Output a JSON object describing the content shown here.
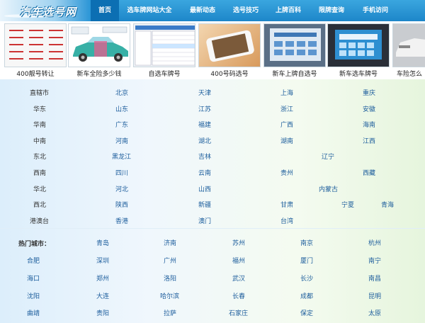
{
  "logo": {
    "text": "汽车选号网"
  },
  "nav": [
    {
      "label": "首页",
      "active": true
    },
    {
      "label": "选车牌网站大全"
    },
    {
      "label": "最新动态"
    },
    {
      "label": "选号技巧"
    },
    {
      "label": "上牌百科"
    },
    {
      "label": "限牌查询"
    },
    {
      "label": "手机访问"
    }
  ],
  "thumbs": [
    {
      "caption": "400靓号转让",
      "icon": "plate-grid-image"
    },
    {
      "caption": "新车全险多少钱",
      "icon": "car-image"
    },
    {
      "caption": "自选车牌号",
      "icon": "table-screenshot-image"
    },
    {
      "caption": "400号码选号",
      "icon": "phone-image"
    },
    {
      "caption": "新车上牌自选号",
      "icon": "kiosk-screen-image"
    },
    {
      "caption": "新车选车牌号",
      "icon": "touchscreen-image"
    },
    {
      "caption": "车险怎么",
      "icon": "car-photo-image"
    }
  ],
  "regions": [
    {
      "region": "直辖市",
      "items": [
        "北京",
        "天津",
        "上海",
        "重庆"
      ]
    },
    {
      "region": "华东",
      "items": [
        "山东",
        "江苏",
        "浙江",
        "安徽"
      ]
    },
    {
      "region": "华南",
      "items": [
        "广东",
        "福建",
        "广西",
        "海南"
      ]
    },
    {
      "region": "中南",
      "items": [
        "河南",
        "湖北",
        "湖南",
        "江西"
      ]
    },
    {
      "region": "东北",
      "items": [
        "黑龙江",
        "吉林",
        "辽宁"
      ]
    },
    {
      "region": "西南",
      "items": [
        "四川",
        "云南",
        "贵州",
        "西藏"
      ]
    },
    {
      "region": "华北",
      "items": [
        "河北",
        "山西",
        "内蒙古"
      ]
    },
    {
      "region": "西北",
      "items": [
        "陕西",
        "新疆",
        "甘肃",
        "宁夏",
        "青海"
      ]
    },
    {
      "region": "港澳台",
      "items": [
        "香港",
        "澳门",
        "台湾"
      ]
    }
  ],
  "hot_cities": {
    "label": "热门城市：",
    "rows": [
      [
        "青岛",
        "济南",
        "苏州",
        "南京",
        "杭州"
      ],
      [
        "合肥",
        "深圳",
        "广州",
        "福州",
        "厦门",
        "南宁"
      ],
      [
        "海口",
        "郑州",
        "洛阳",
        "武汉",
        "长沙",
        "南昌"
      ],
      [
        "沈阳",
        "大连",
        "哈尔滨",
        "长春",
        "成都",
        "昆明"
      ],
      [
        "曲靖",
        "贵阳",
        "拉萨",
        "石家庄",
        "保定",
        "太原"
      ]
    ]
  },
  "colors": {
    "nav_bg": "#2a95d6",
    "nav_active": "#0c6fb3",
    "link": "#1c5d9c"
  }
}
